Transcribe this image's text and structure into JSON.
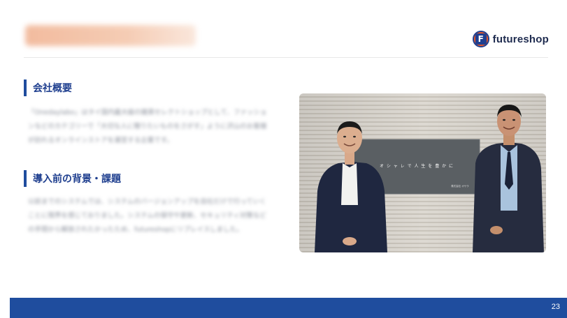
{
  "header": {
    "brand": {
      "mark_letter": "F",
      "name": "futureshop"
    }
  },
  "sections": [
    {
      "heading": "会社概要",
      "body": "「Onedaylabo」はタイ国内最大級の雑貨セレクトショップとして、ファッションなどのカテゴリーで「大切な人に贈りたいものをさがす」ように沢山のお客様が訪れるオンラインストアを運営する企業です。"
    },
    {
      "heading": "導入前の背景・課題",
      "body": "以前までのシステムでは、システムのバージョンアップを自社だけで行っていくことに限界を感じておりました。システムの保守や更新、セキュリティ対策などの手間から解放されたかったため、futureshopにリプレイスしました。"
    }
  ],
  "photo": {
    "sign_text": "オ シ ャ レ で 人 生 を 豊 か に",
    "sign_small": "株式会社 オサラ"
  },
  "footer": {
    "page_number": "23"
  },
  "colors": {
    "accent_blue": "#1f4d9e",
    "heading_blue": "#1f3f8f",
    "logo_orange": "#e8572a"
  }
}
